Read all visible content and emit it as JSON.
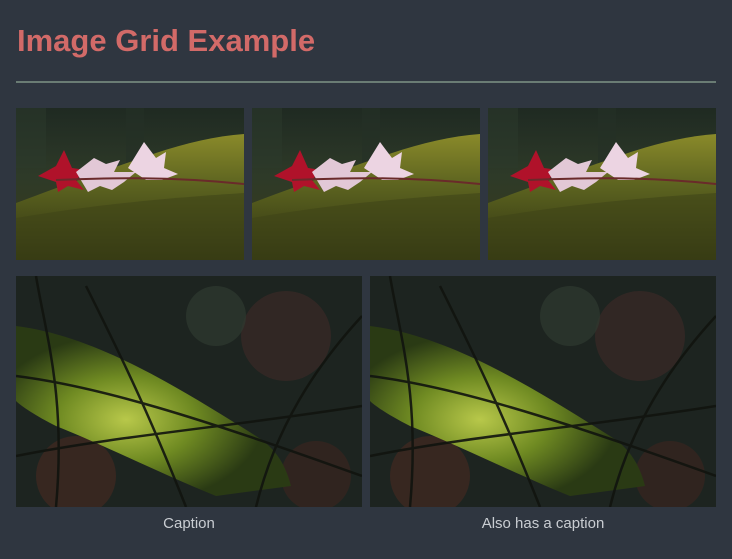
{
  "page": {
    "title": "Image Grid Example"
  },
  "grid": {
    "row1": [
      {
        "image": "red-leaf-on-moss-photo"
      },
      {
        "image": "red-leaf-on-moss-photo"
      },
      {
        "image": "red-leaf-on-moss-photo"
      }
    ],
    "row2": [
      {
        "image": "mossy-branch-photo",
        "caption": "Caption"
      },
      {
        "image": "mossy-branch-photo",
        "caption": "Also has a caption"
      }
    ]
  },
  "colors": {
    "background": "#2f3640",
    "title": "#d26a68",
    "divider": "#6a7c74",
    "caption": "#c9cdd2"
  }
}
